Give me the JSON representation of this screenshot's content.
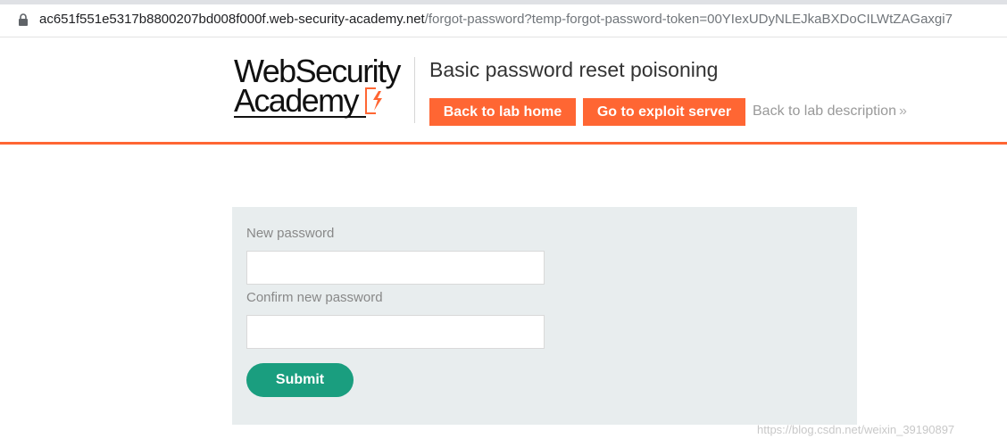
{
  "browser": {
    "url_domain": "ac651f551e5317b8800207bd008f000f.web-security-academy.net",
    "url_path": "/forgot-password?temp-forgot-password-token=00YIexUDyNLEJkaBXDoCILWtZAGaxgi7"
  },
  "header": {
    "logo_line1": "WebSecurity",
    "logo_line2": "Academy",
    "lab_title": "Basic password reset poisoning",
    "back_to_lab_home": "Back to lab home",
    "go_to_exploit_server": "Go to exploit server",
    "back_to_lab_description": "Back to lab description",
    "accent_color": "#ff6633"
  },
  "form": {
    "new_password_label": "New password",
    "new_password_value": "",
    "confirm_password_label": "Confirm new password",
    "confirm_password_value": "",
    "submit_label": "Submit",
    "submit_color": "#1a9e7f"
  },
  "watermark": "https://blog.csdn.net/weixin_39190897"
}
